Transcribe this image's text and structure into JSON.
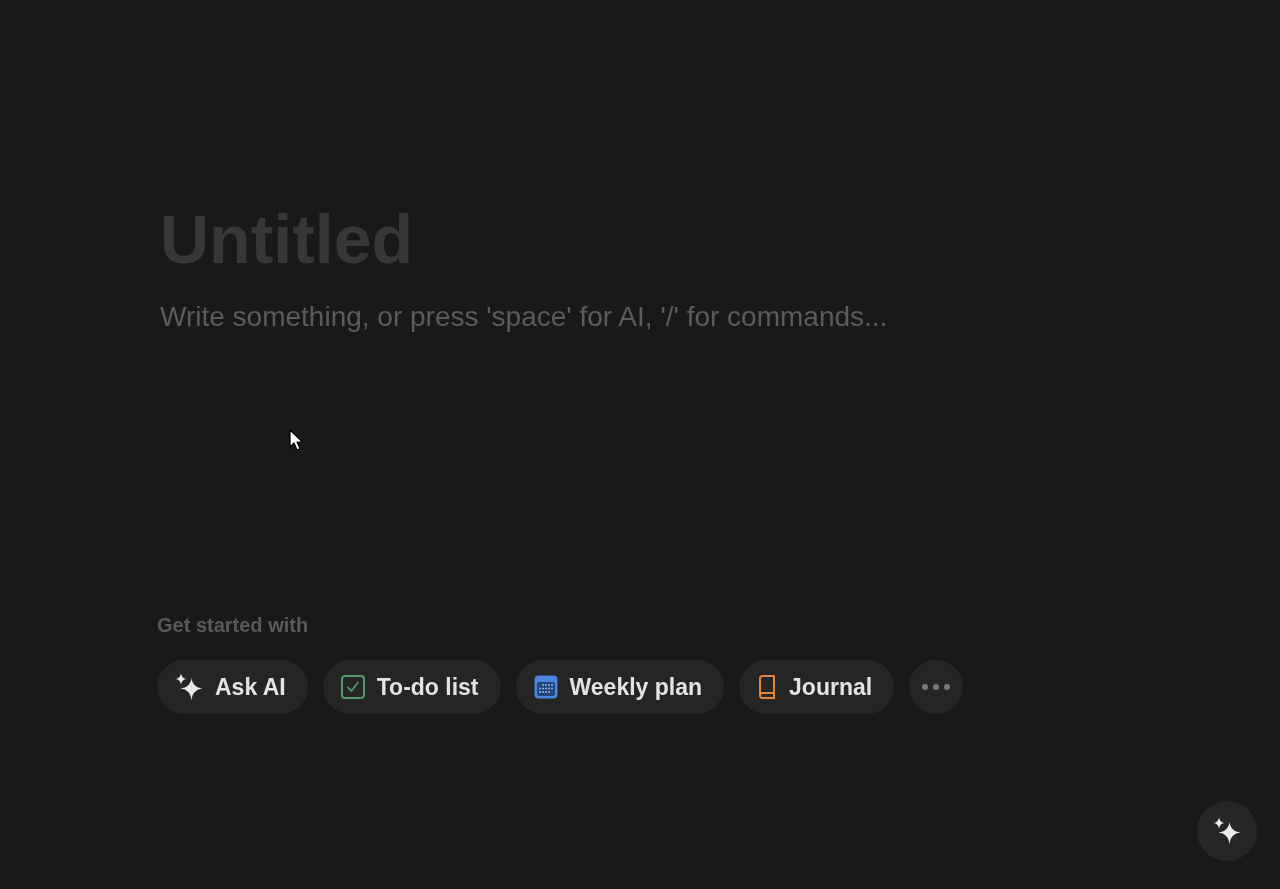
{
  "editor": {
    "title": {
      "placeholder": "Untitled"
    },
    "body": {
      "placeholder": "Write something, or press 'space' for AI, '/' for commands..."
    }
  },
  "get_started": {
    "label": "Get started with",
    "items": [
      {
        "kind": "ai",
        "label": "Ask AI"
      },
      {
        "kind": "todo",
        "label": "To-do list"
      },
      {
        "kind": "calendar",
        "label": "Weekly plan"
      },
      {
        "kind": "journal",
        "label": "Journal"
      },
      {
        "kind": "more"
      }
    ]
  }
}
